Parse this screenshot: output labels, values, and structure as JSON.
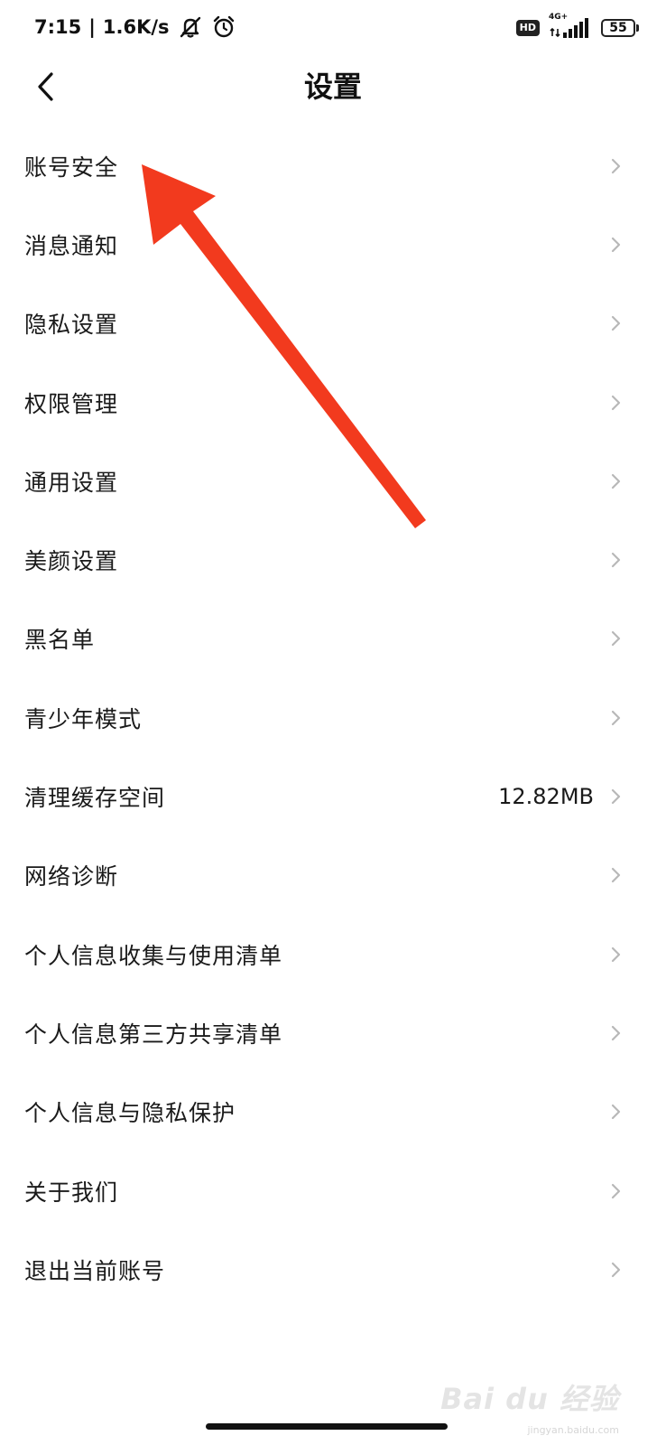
{
  "status_bar": {
    "time": "7:15",
    "separator": "|",
    "net_speed": "1.6K/s",
    "hd_badge": "HD",
    "network_type": "4G+",
    "battery_level": "55",
    "icons": [
      "mute-icon",
      "alarm-icon",
      "signal-icon",
      "battery-icon"
    ]
  },
  "header": {
    "title": "设置",
    "back_icon": "back-arrow-icon"
  },
  "settings": {
    "items": [
      {
        "label": "账号安全",
        "value": ""
      },
      {
        "label": "消息通知",
        "value": ""
      },
      {
        "label": "隐私设置",
        "value": ""
      },
      {
        "label": "权限管理",
        "value": ""
      },
      {
        "label": "通用设置",
        "value": ""
      },
      {
        "label": "美颜设置",
        "value": ""
      },
      {
        "label": "黑名单",
        "value": ""
      },
      {
        "label": "青少年模式",
        "value": ""
      },
      {
        "label": "清理缓存空间",
        "value": "12.82MB"
      },
      {
        "label": "网络诊断",
        "value": ""
      },
      {
        "label": "个人信息收集与使用清单",
        "value": ""
      },
      {
        "label": "个人信息第三方共享清单",
        "value": ""
      },
      {
        "label": "个人信息与隐私保护",
        "value": ""
      },
      {
        "label": "关于我们",
        "value": ""
      },
      {
        "label": "退出当前账号",
        "value": ""
      }
    ]
  },
  "annotation": {
    "color": "#f23a1e"
  },
  "watermark": {
    "text": "Bai du 经验",
    "sub": "jingyan.baidu.com"
  },
  "colors": {
    "text": "#1a1a1a",
    "chevron": "#b8b8b8",
    "background": "#ffffff"
  }
}
